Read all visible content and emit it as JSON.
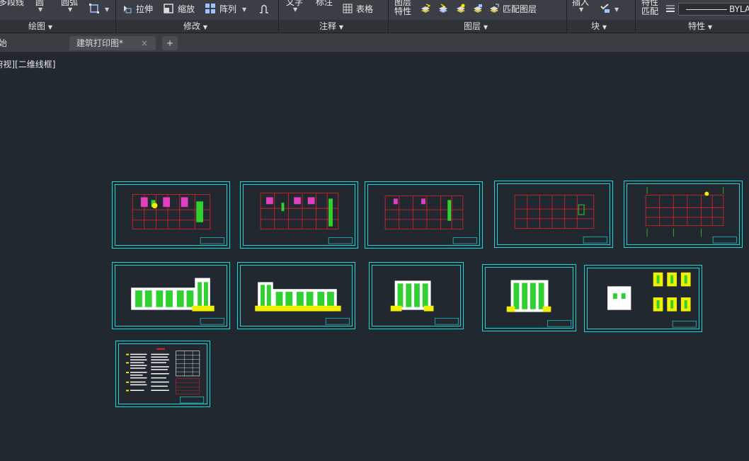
{
  "ribbon": {
    "draw_row1": [
      "多段线",
      "圆",
      "圆弧"
    ],
    "modify_row": {
      "stretch": "拉伸",
      "scale": "缩放",
      "array": "阵列"
    },
    "annotate_row1": [
      "文字",
      "标注"
    ],
    "annotate_table": "表格",
    "layer_props": [
      "图层",
      "特性"
    ],
    "match_layer": "匹配图层",
    "block_insert": "插入",
    "props_match": [
      "特性",
      "匹配"
    ],
    "bylayer": "BYLA",
    "groups": {
      "draw": "绘图",
      "modify": "修改",
      "annotate": "注释",
      "layer": "图层",
      "block": "块",
      "properties": "特性"
    }
  },
  "tabs": {
    "start": "开始",
    "active": "建筑打印图*",
    "close": "×",
    "add": "+"
  },
  "viewport": {
    "label": "[-][俯视][二维线框]"
  },
  "colors": {
    "frame": "#18d8d8",
    "grid_red": "#e8202a",
    "green": "#30d030",
    "magenta": "#e040c0",
    "yellow": "#f0f000",
    "white": "#ffffff"
  }
}
